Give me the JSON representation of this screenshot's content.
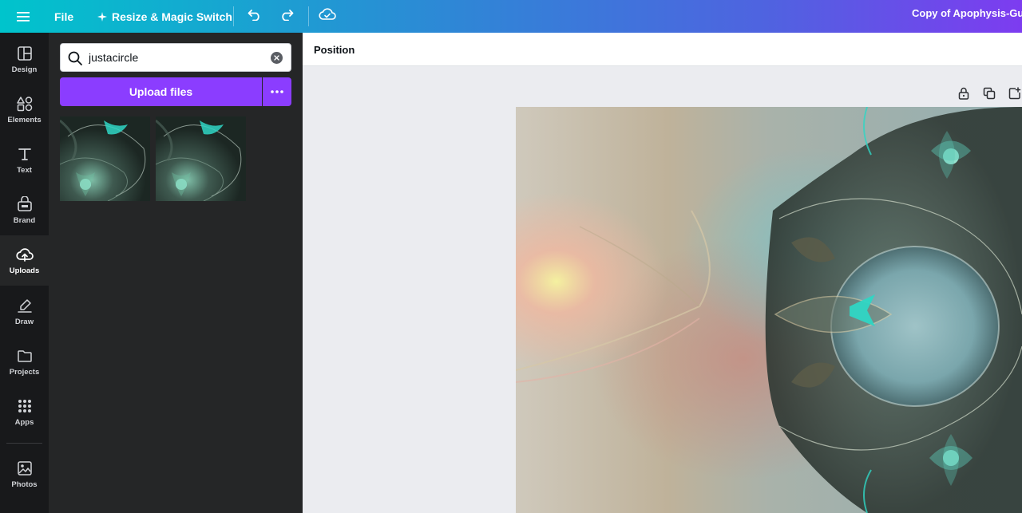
{
  "topbar": {
    "file_label": "File",
    "resize_label": "Resize & Magic Switch",
    "doc_title": "Copy of Apophysis-Gut",
    "icons": {
      "menu": "hamburger-icon",
      "resize": "magic-sparkle-icon",
      "undo": "undo-icon",
      "redo": "redo-icon",
      "cloud": "cloud-check-icon"
    }
  },
  "rail": {
    "items": [
      {
        "label": "Design",
        "icon": "layout-icon"
      },
      {
        "label": "Elements",
        "icon": "shapes-icon"
      },
      {
        "label": "Text",
        "icon": "text-icon"
      },
      {
        "label": "Brand",
        "icon": "brand-icon"
      },
      {
        "label": "Uploads",
        "icon": "cloud-upload-icon"
      },
      {
        "label": "Draw",
        "icon": "pen-icon"
      },
      {
        "label": "Projects",
        "icon": "folder-icon"
      },
      {
        "label": "Apps",
        "icon": "grid-icon"
      },
      {
        "label": "Photos",
        "icon": "image-icon"
      }
    ],
    "active": "Uploads"
  },
  "panel": {
    "search_value": "justacircle",
    "upload_label": "Upload files"
  },
  "context_bar": {
    "position_label": "Position"
  },
  "colors": {
    "accent": "#8b3dff",
    "rail_bg": "#18191b",
    "panel_bg": "#252627",
    "canvas_bg": "#ebecf0"
  }
}
